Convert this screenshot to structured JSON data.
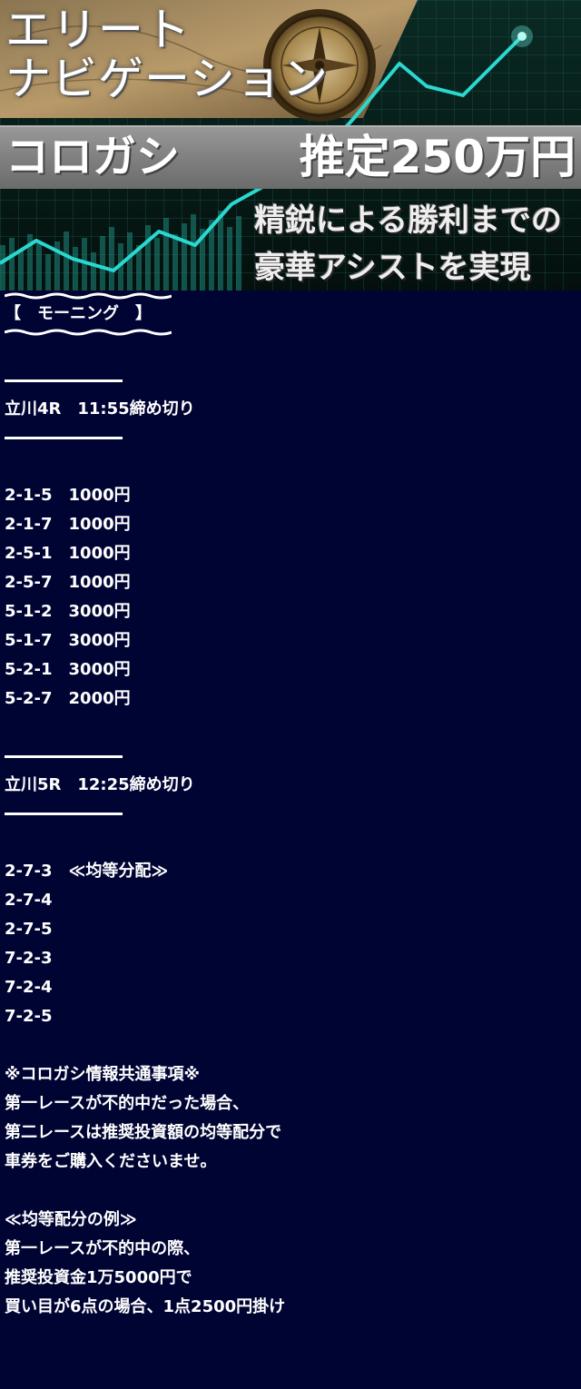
{
  "banner": {
    "title_line1": "エリート",
    "title_line2": "ナビゲーション",
    "bar_left": "コロガシ",
    "bar_right": "推定250万円",
    "sub_line1": "精鋭による勝利までの",
    "sub_line2": "豪華アシストを実現",
    "icons": [
      "compass-icon",
      "rising-line-chart"
    ],
    "colors": {
      "background": "#000433",
      "chart_line": "#2ad8d0",
      "bar": "#888888"
    }
  },
  "section": {
    "heading": "【　モーニング　】"
  },
  "race1": {
    "title": "立川4R　11:55締め切り",
    "bets": [
      "2-1-5　1000円",
      "2-1-7　1000円",
      "2-5-1　1000円",
      "2-5-7　1000円",
      "5-1-2　3000円",
      "5-1-7　3000円",
      "5-2-1　3000円",
      "5-2-7　2000円"
    ]
  },
  "race2": {
    "title": "立川5R　12:25締め切り",
    "bets": [
      "2-7-3　≪均等分配≫",
      "2-7-4",
      "2-7-5",
      "7-2-3",
      "7-2-4",
      "7-2-5"
    ]
  },
  "notes": {
    "heading": "※コロガシ情報共通事項※",
    "lines": [
      "第一レースが不的中だった場合、",
      "第二レースは推奨投資額の均等配分で",
      "車券をご購入くださいませ。"
    ],
    "example_heading": "≪均等配分の例≫",
    "example_lines": [
      "第一レースが不的中の際、",
      "推奨投資金1万5000円で",
      "買い目が6点の場合、1点2500円掛け"
    ]
  }
}
